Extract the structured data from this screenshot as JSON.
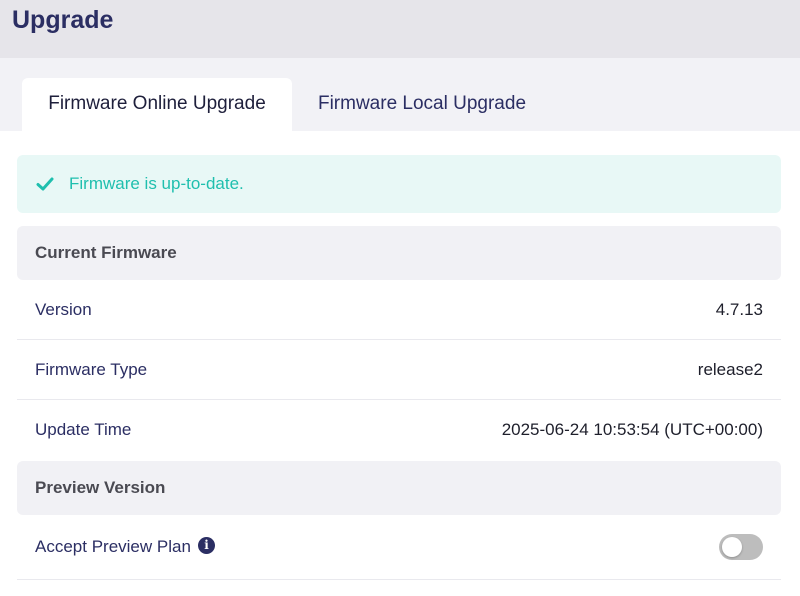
{
  "header": {
    "title": "Upgrade"
  },
  "tabs": [
    {
      "label": "Firmware Online Upgrade",
      "active": true
    },
    {
      "label": "Firmware Local Upgrade",
      "active": false
    }
  ],
  "alert": {
    "icon": "check-icon",
    "message": "Firmware is up-to-date.",
    "color": "#1fbfae",
    "background": "#e8f8f6"
  },
  "current_firmware": {
    "title": "Current Firmware",
    "rows": [
      {
        "label": "Version",
        "value": "4.7.13"
      },
      {
        "label": "Firmware Type",
        "value": "release2"
      },
      {
        "label": "Update Time",
        "value": "2025-06-24 10:53:54 (UTC+00:00)"
      }
    ]
  },
  "preview_version": {
    "title": "Preview Version",
    "accept_label": "Accept Preview Plan",
    "info_icon": "info-icon",
    "accept_enabled": false
  },
  "colors": {
    "title": "#2b2e63",
    "accent": "#1fbfae",
    "toggle_off": "#bdbdbd"
  }
}
